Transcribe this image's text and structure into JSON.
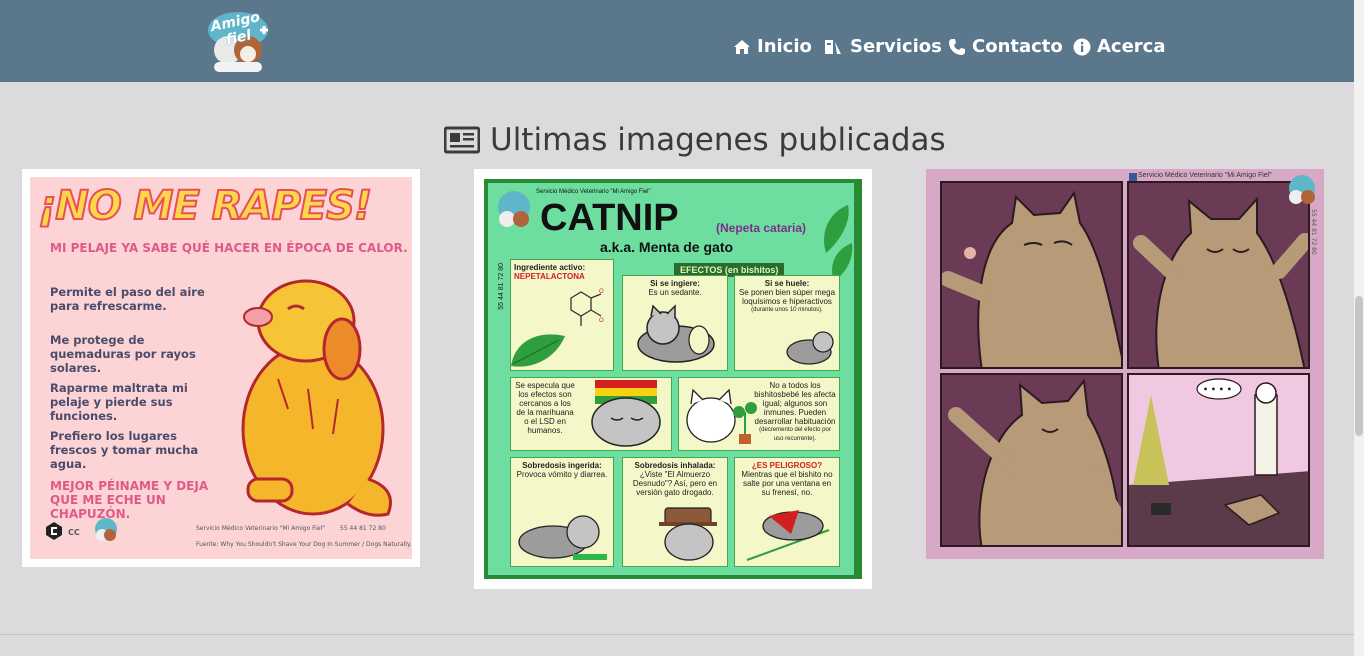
{
  "brand": {
    "logo_text": "Amigo fiel"
  },
  "nav": {
    "inicio": "Inicio",
    "servicios": "Servicios",
    "contacto": "Contacto",
    "acerca": "Acerca"
  },
  "section": {
    "title": "Ultimas imagenes publicadas"
  },
  "cards": [
    {
      "title": "¡NO ME RAPES!",
      "subtitle": "MI PELAJE YA SABE QUÉ HACER EN ÉPOCA DE CALOR.",
      "p1": "Permite el paso del aire para refrescarme.",
      "p2": "Me protege de quemaduras por rayos solares.",
      "p3": "Raparme maltrata mi pelaje y pierde sus funciones.",
      "p4": "Prefiero los lugares frescos y tomar mucha agua.",
      "closing": "MEJOR PÉINAME Y DEJA QUE ME ECHE UN CHAPUZÓN.",
      "cc": "CC",
      "credit": "Servicio Médico Veterinario \"Mi Amigo Fiel\"",
      "phone": "55 44 81 72 80",
      "source": "Fuente: Why You Shouldn't Shave Your Dog In Summer / Dogs Naturally."
    },
    {
      "header": "Servicio Médico Veterinario \"Mi Amigo Fiel\"",
      "title": "CATNIP",
      "scientific": "(Nepeta cataria)",
      "aka": "a.k.a. Menta de gato",
      "efectos": "EFECTOS (en bishitos)",
      "phone": "55 44 81 72 80",
      "ingrediente_label": "Ingrediente activo:",
      "ingrediente_value": "NEPETALACTONA",
      "ingiere_label": "Si se ingiere:",
      "ingiere_text": "Es un sedante.",
      "huele_label": "Si se huele:",
      "huele_text": "Se ponen bien súper mega loquísimos e hiperactivos",
      "huele_note": "(durante unos 10 minutos).",
      "especula": "Se especula que los efectos son cercanos a los de la marihuana o el LSD en humanos.",
      "no_todos": "No a todos los bishitosbebé les afecta igual; algunos son inmunes. Pueden desarrollar habituación",
      "no_todos_note": "(decremento del efecto por uso recurrente).",
      "ingerida_label": "Sobredosis ingerida:",
      "ingerida_text": "Provoca vómito y diarrea.",
      "inhalada_label": "Sobredosis inhalada:",
      "inhalada_text": "¿Viste \"El Almuerzo Desnudo\"? Así, pero en versión gato drogado.",
      "peligroso_label": "¿ES PELIGROSO?",
      "peligroso_text": "Mientras que el bishito no salte por una ventana en su frenesí, no."
    },
    {
      "header": "Servicio Médico Veterinario \"Mi Amigo Fiel\"",
      "phone": "55 44 81 72 80",
      "bubble": "• • • •"
    }
  ]
}
